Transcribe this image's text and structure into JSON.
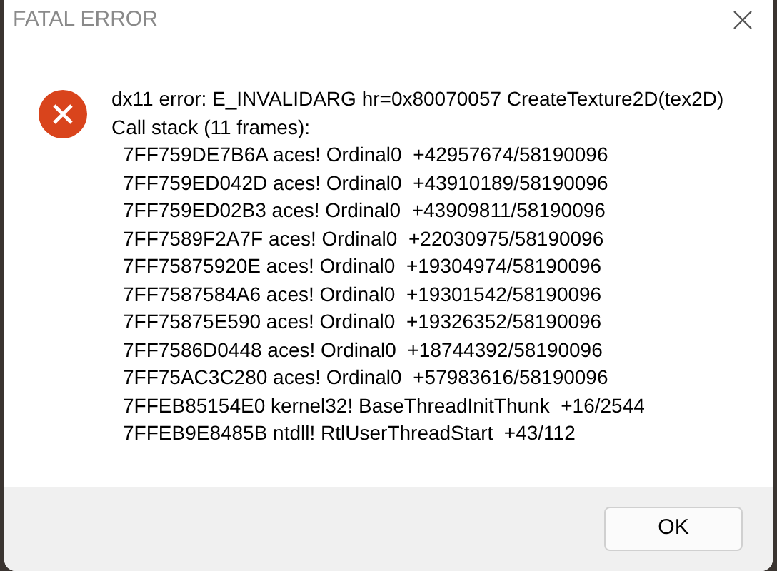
{
  "window": {
    "title": "FATAL ERROR"
  },
  "message": {
    "headline": "dx11 error: E_INVALIDARG hr=0x80070057 CreateTexture2D(tex2D)",
    "stack_heading": "Call stack (11 frames):",
    "frames": [
      "7FF759DE7B6A aces! Ordinal0  +42957674/58190096",
      "7FF759ED042D aces! Ordinal0  +43910189/58190096",
      "7FF759ED02B3 aces! Ordinal0  +43909811/58190096",
      "7FF7589F2A7F aces! Ordinal0  +22030975/58190096",
      "7FF75875920E aces! Ordinal0  +19304974/58190096",
      "7FF7587584A6 aces! Ordinal0  +19301542/58190096",
      "7FF75875E590 aces! Ordinal0  +19326352/58190096",
      "7FF7586D0448 aces! Ordinal0  +18744392/58190096",
      "7FF75AC3C280 aces! Ordinal0  +57983616/58190096",
      "7FFEB85154E0 kernel32! BaseThreadInitThunk  +16/2544",
      "7FFEB9E8485B ntdll! RtlUserThreadStart  +43/112"
    ]
  },
  "buttons": [
    "OK"
  ]
}
